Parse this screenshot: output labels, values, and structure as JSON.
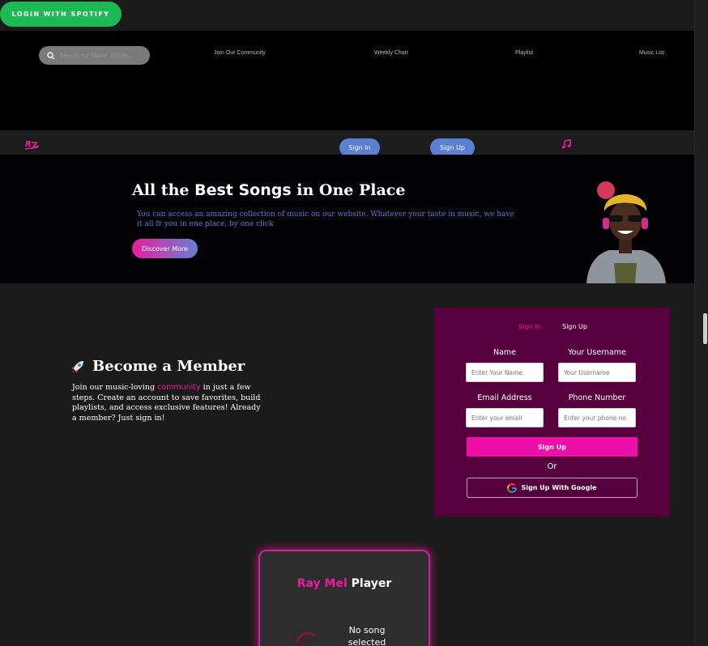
{
  "spotify": {
    "label": "LOGIN WITH SPOTIFY"
  },
  "search": {
    "placeholder": "Search for Music, Artists..."
  },
  "nav": [
    "Join Our Community",
    "Weekly Chart",
    "Playlist",
    "Music List"
  ],
  "subbar": {
    "sign_in": "Sign In",
    "sign_up": "Sign Up"
  },
  "hero": {
    "title_pre": "All the ",
    "title_bold": "Best Songs",
    "title_post": " in One Place",
    "description": "You can access an amazing collection of music on our website. Whatever your taste in music, we have it all fr you in one place, by one click",
    "cta": "Discover More"
  },
  "member": {
    "title": "Become a Member",
    "text_pre": "Join our music-loving ",
    "text_link": "community",
    "text_post": " in just a few steps. Create an account to save favorites, build playlists, and access exclusive features! Already a member? Just sign in!"
  },
  "form": {
    "tab_signin": "Sign In",
    "tab_signup": "Sign Up",
    "name_label": "Name",
    "name_placeholder": "Enter Your Name",
    "username_label": "Your Username",
    "username_placeholder": "Your Username",
    "email_label": "Email Address",
    "email_placeholder": "Enter your email",
    "phone_label": "Phone Number",
    "phone_placeholder": "Enter your phone no",
    "submit": "Sign Up",
    "or": "Or",
    "google": "Sign Up With Google"
  },
  "player": {
    "title_a": "Ray Mel",
    "title_b": " Player",
    "status": "No song selected"
  },
  "colors": {
    "accent": "#e91e9c",
    "brand_blue": "#5b7fd1",
    "spotify": "#1db954",
    "form_bg": "#56003e"
  }
}
